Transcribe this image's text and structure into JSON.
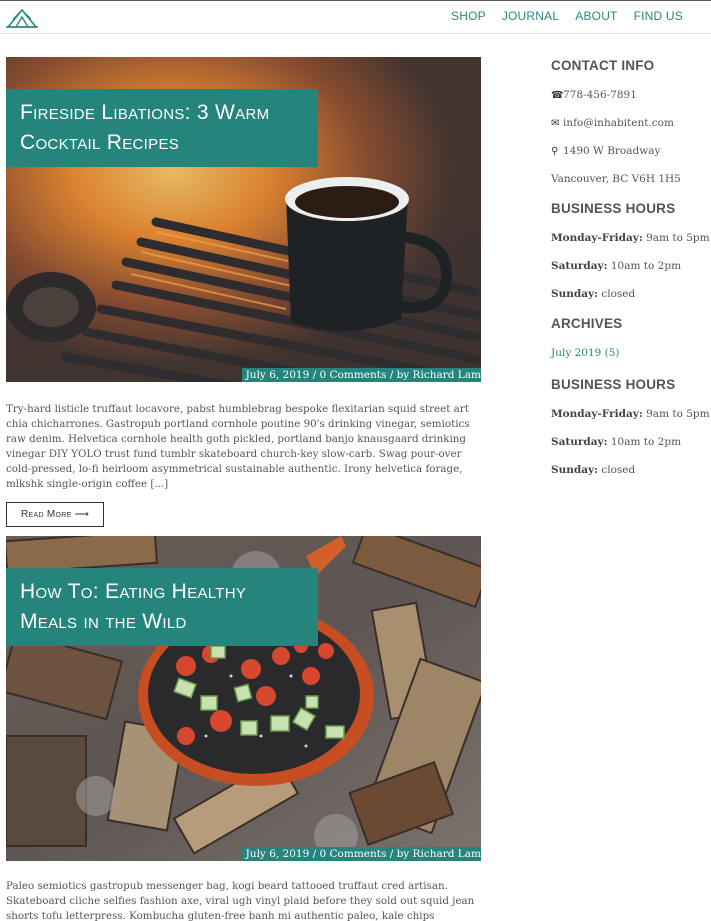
{
  "nav": {
    "logo_icon": "tent-logo-icon",
    "items": [
      "SHOP",
      "JOURNAL",
      "ABOUT",
      "FIND US"
    ]
  },
  "posts": [
    {
      "title": "Fireside Libations: 3 Warm Cocktail Recipes",
      "meta": "July 6, 2019 / 0 Comments / by Richard Lam",
      "excerpt": "Try-hard listicle truffaut locavore, pabst humblebrag bespoke flexitarian squid street art chia chicharrones. Gastropub portland cornhole poutine 90's drinking vinegar, semiotics raw denim. Helvetica cornhole health goth pickled, portland banjo knausgaard drinking vinegar DIY YOLO trust fund tumblr skateboard church-key slow-carb. Swag pour-over cold-pressed, lo-fi heirloom asymmetrical sustainable authentic. Irony helvetica forage, mlkshk single-origin coffee [...]",
      "read_more": "Read More ⟶"
    },
    {
      "title": "How To: Eating Healthy Meals in the Wild",
      "meta": "July 6, 2019 / 0 Comments / by Richard Lam",
      "excerpt": "Paleo semiotics gastropub messenger bag, kogi beard tattooed truffaut cred artisan. Skateboard cliche selfies fashion axe, viral ugh vinyl plaid before they sold out squid jean shorts tofu letterpress. Kombucha gluten-free banh mi authentic paleo, kale chips typewriter kogi"
    }
  ],
  "sidebar": {
    "contact_heading": "CONTACT INFO",
    "phone": "778-456-7891",
    "email": "info@inhabitent.com",
    "address1": "1490 W Broadway",
    "address2": "Vancouver, BC V6H 1H5",
    "hours_heading": "BUSINESS HOURS",
    "hours": [
      {
        "day": "Monday-Friday:",
        "time": "9am to 5pm"
      },
      {
        "day": "Saturday:",
        "time": "10am to 2pm"
      },
      {
        "day": "Sunday:",
        "time": "closed"
      }
    ],
    "archives_heading": "ARCHIVES",
    "archive_link": "July 2019 (5)",
    "hours_heading_2": "BUSINESS HOURS",
    "hours_2": [
      {
        "day": "Monday-Friday:",
        "time": "9am to 5pm"
      },
      {
        "day": "Saturday:",
        "time": "10am to 2pm"
      },
      {
        "day": "Sunday:",
        "time": "closed"
      }
    ]
  },
  "colors": {
    "accent": "#25857d",
    "text": "#555555"
  }
}
